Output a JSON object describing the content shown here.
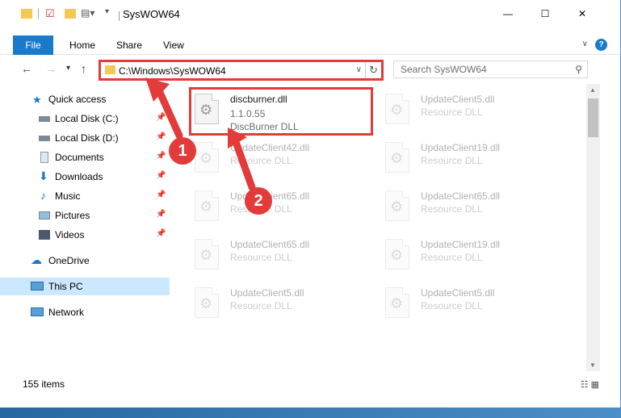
{
  "window": {
    "title": "SysWOW64",
    "controls": {
      "minimize": "—",
      "maximize": "☐",
      "close": "✕"
    }
  },
  "ribbon": {
    "tabs": [
      "File",
      "Home",
      "Share",
      "View"
    ],
    "help": "?"
  },
  "address": {
    "path": "C:\\Windows\\SysWOW64",
    "search_placeholder": "Search SysWOW64"
  },
  "nav": {
    "items": [
      {
        "label": "Quick access",
        "icon": "star-icon",
        "pinned": false
      },
      {
        "label": "Local Disk (C:)",
        "icon": "drive-icon",
        "pinned": true
      },
      {
        "label": "Local Disk (D:)",
        "icon": "drive-icon",
        "pinned": true
      },
      {
        "label": "Documents",
        "icon": "document-icon",
        "pinned": true
      },
      {
        "label": "Downloads",
        "icon": "download-icon",
        "pinned": true
      },
      {
        "label": "Music",
        "icon": "music-icon",
        "pinned": true
      },
      {
        "label": "Pictures",
        "icon": "picture-icon",
        "pinned": true
      },
      {
        "label": "Videos",
        "icon": "video-icon",
        "pinned": true
      },
      {
        "label": "OneDrive",
        "icon": "cloud-icon",
        "pinned": false
      },
      {
        "label": "This PC",
        "icon": "computer-icon",
        "pinned": false,
        "selected": true
      },
      {
        "label": "Network",
        "icon": "network-icon",
        "pinned": false
      }
    ]
  },
  "files": {
    "highlighted": {
      "name": "discburner.dll",
      "version": "1.1.0.55",
      "description": "DiscBurner DLL"
    },
    "faded": [
      {
        "name": "UpdateClient5.dll",
        "description": "Resource DLL"
      },
      {
        "name": "UpdateClient42.dll",
        "description": "Resource DLL"
      },
      {
        "name": "UpdateClient19.dll",
        "description": "Resource DLL"
      },
      {
        "name": "UpdateClient65.dll",
        "description": "Resource DLL"
      },
      {
        "name": "UpdateClient65.dll",
        "description": "Resource DLL"
      },
      {
        "name": "UpdateClient65.dll",
        "description": "Resource DLL"
      },
      {
        "name": "UpdateClient19.dll",
        "description": "Resource DLL"
      },
      {
        "name": "UpdateClient5.dll",
        "description": "Resource DLL"
      },
      {
        "name": "UpdateClient5.dll",
        "description": "Resource DLL"
      }
    ]
  },
  "status": {
    "item_count": "155 items"
  },
  "callouts": [
    "1",
    "2"
  ],
  "colors": {
    "accent": "#1979ca",
    "annotation": "#e33a3a",
    "selected": "#cce8ff"
  }
}
